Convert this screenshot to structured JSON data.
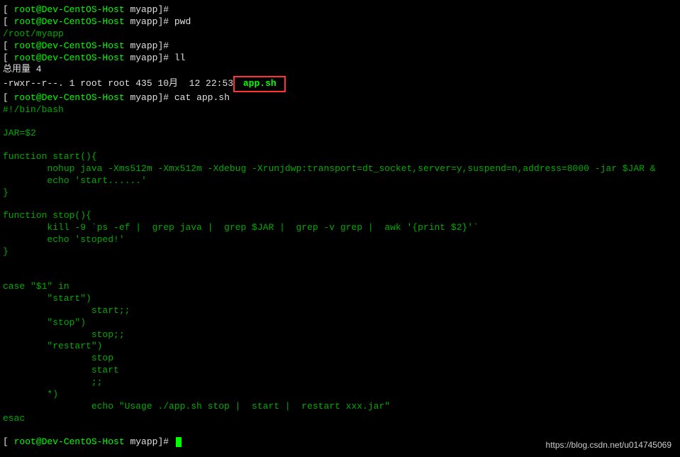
{
  "prompt": {
    "open_bracket": "[",
    "user_host": " root@Dev-CentOS-Host",
    "path": " myapp",
    "close": "]#"
  },
  "cmd": {
    "pwd": " pwd",
    "ll": " ll",
    "cat": " cat app.sh"
  },
  "output": {
    "pwd_result": "/root/myapp",
    "ll_total": "总用量 4",
    "ll_perms": "-rwxr--r--. 1 root root 435 10月  12 22:53",
    "ll_file": " app.sh ",
    "shebang": "#!/bin/bash",
    "jar_var": "JAR=$2",
    "fn_start": "function start(){",
    "start_nohup": "        nohup java -Xms512m -Xmx512m -Xdebug -Xrunjdwp:transport=dt_socket,server=y,suspend=n,address=8000 -jar $JAR &",
    "start_echo": "        echo 'start......'",
    "brace_close": "}",
    "fn_stop": "function stop(){",
    "stop_kill": "        kill -9 `ps -ef |  grep java |  grep $JAR |  grep -v grep |  awk '{print $2}'`",
    "stop_echo": "        echo 'stoped!'",
    "case_start": "case \"$1\" in",
    "case_start_opt": "        \"start\")",
    "case_start_call": "                start;;",
    "case_stop_opt": "        \"stop\")",
    "case_stop_call": "                stop;;",
    "case_restart_opt": "        \"restart\")",
    "case_restart_stop": "                stop",
    "case_restart_start": "                start",
    "case_restart_sep": "                ;;",
    "case_default": "        *)",
    "case_usage": "                echo \"Usage ./app.sh stop |  start |  restart xxx.jar\"",
    "esac": "esac"
  },
  "watermark": "https://blog.csdn.net/u014745069"
}
